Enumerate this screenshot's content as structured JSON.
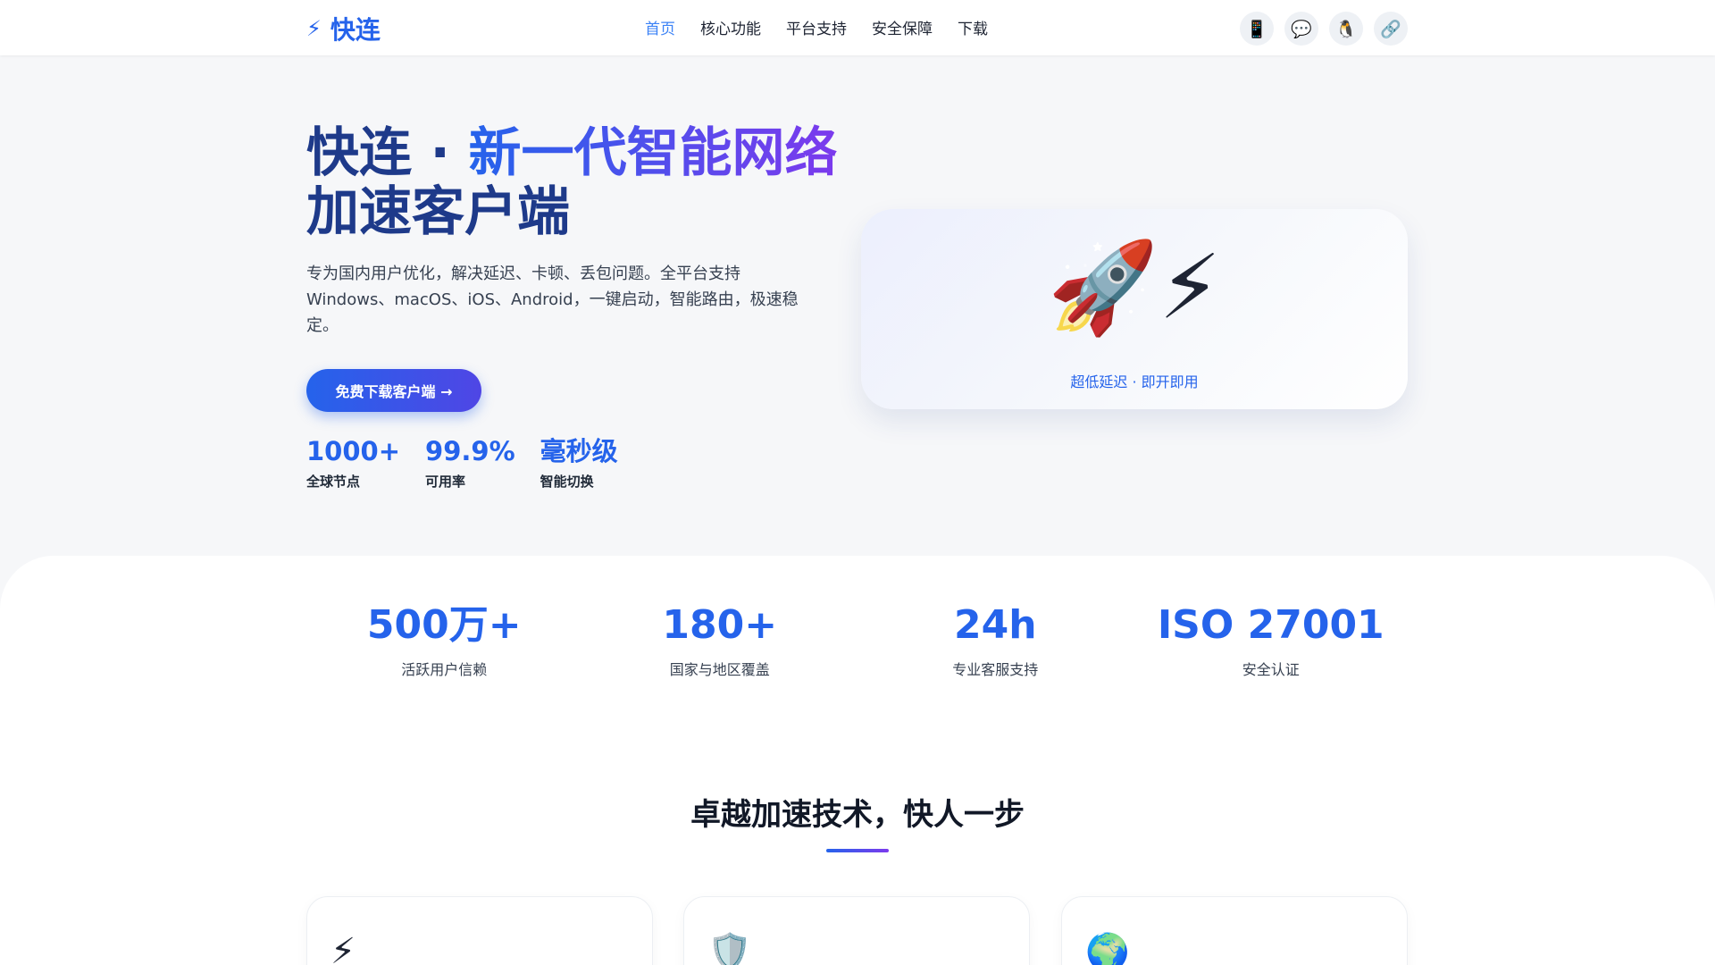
{
  "nav": {
    "logo": "快连",
    "logo_icon": "lightning-icon",
    "items": [
      "首页",
      "核心功能",
      "平台支持",
      "安全保障",
      "下载"
    ],
    "active_index": 0,
    "social_icons": [
      "phone-icon",
      "chat-icon",
      "penguin-icon",
      "link-icon"
    ]
  },
  "hero": {
    "title_plain": "快连 · ",
    "title_highlight": "新一代智能网络",
    "title_line2": "加速客户端",
    "description": "专为国内用户优化，解决延迟、卡顿、丢包问题。全平台支持Windows、macOS、iOS、Android，一键启动，智能路由，极速稳定。",
    "cta": "免费下载客户端 →",
    "mini_stats": [
      {
        "value": "1000+",
        "label": "全球节点"
      },
      {
        "value": "99.9%",
        "label": "可用率"
      },
      {
        "value": "毫秒级",
        "label": "智能切换"
      }
    ],
    "card_caption": "超低延迟 · 即开即用",
    "card_icons": [
      "rocket-icon",
      "lightning-icon"
    ]
  },
  "stats": [
    {
      "value": "500万+",
      "label": "活跃用户信赖"
    },
    {
      "value": "180+",
      "label": "国家与地区覆盖"
    },
    {
      "value": "24h",
      "label": "专业客服支持"
    },
    {
      "value": "ISO 27001",
      "label": "安全认证"
    }
  ],
  "features": {
    "title": "卓越加速技术，快人一步",
    "card_icons": [
      "lightning-icon",
      "shield-icon",
      "globe-icon"
    ]
  },
  "colors": {
    "accent": "#2563eb",
    "accent_purple": "#7c3aed",
    "title_dark": "#1e3a8a"
  }
}
